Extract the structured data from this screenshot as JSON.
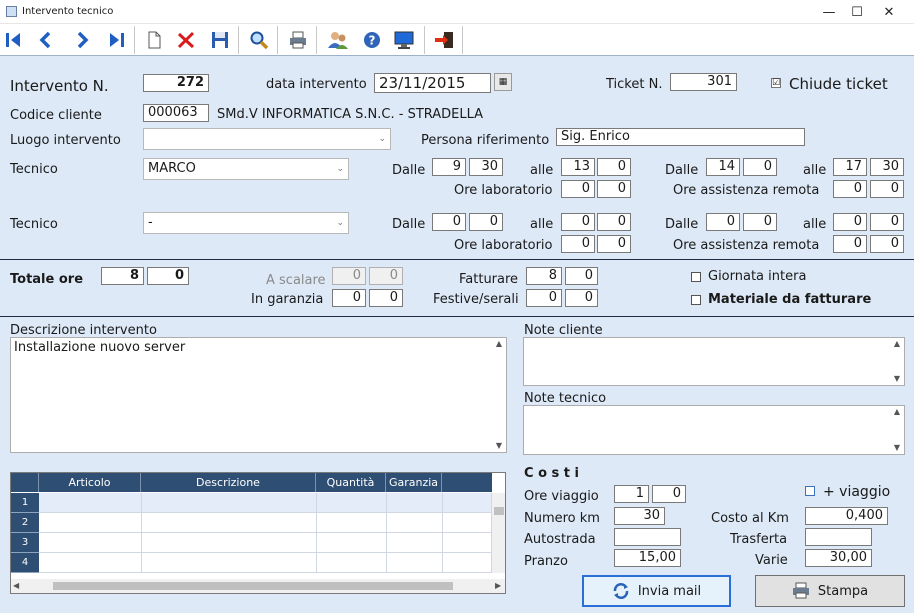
{
  "window": {
    "title": "Intervento tecnico",
    "minimize_icon": "minimize-icon",
    "maximize_icon": "maximize-icon",
    "close_icon": "close-icon"
  },
  "toolbar": {
    "icons": [
      "first-record-icon",
      "prev-record-icon",
      "next-record-icon",
      "last-record-icon",
      "new-document-icon",
      "delete-icon",
      "save-icon",
      "search-icon",
      "print-icon",
      "users-icon",
      "help-icon",
      "monitor-icon",
      "exit-icon"
    ]
  },
  "header": {
    "intervento_label": "Intervento N.",
    "intervento_value": "272",
    "data_label": "data intervento",
    "data_value": "23/11/2015",
    "ticket_label": "Ticket N.",
    "ticket_value": "301",
    "chiude_label": "Chiude ticket",
    "chiude_checked": "☑",
    "codice_label": "Codice cliente",
    "codice_value": "000063",
    "cliente_nome": "SMd.V INFORMATICA S.N.C. - STRADELLA",
    "luogo_label": "Luogo intervento",
    "luogo_value": "",
    "persona_label": "Persona riferimento",
    "persona_value": "Sig. Enrico"
  },
  "tecnici": [
    {
      "label": "Tecnico",
      "name": "MARCO",
      "dalle": "Dalle",
      "alle": "alle",
      "d1h": "9",
      "d1m": "30",
      "a1h": "13",
      "a1m": "0",
      "d2h": "14",
      "d2m": "0",
      "a2h": "17",
      "a2m": "30",
      "lab_label": "Ore laboratorio",
      "lab_h": "0",
      "lab_m": "0",
      "rem_label": "Ore assistenza remota",
      "rem_h": "0",
      "rem_m": "0"
    },
    {
      "label": "Tecnico",
      "name": "-",
      "dalle": "Dalle",
      "alle": "alle",
      "d1h": "0",
      "d1m": "0",
      "a1h": "0",
      "a1m": "0",
      "d2h": "0",
      "d2m": "0",
      "a2h": "0",
      "a2m": "0",
      "lab_label": "Ore laboratorio",
      "lab_h": "0",
      "lab_m": "0",
      "rem_label": "Ore assistenza remota",
      "rem_h": "0",
      "rem_m": "0"
    }
  ],
  "totali": {
    "totale_label": "Totale ore",
    "totale_h": "8",
    "totale_m": "0",
    "scalare_label": "A scalare",
    "scalare_h": "0",
    "scalare_m": "0",
    "garanzia_label": "In garanzia",
    "garanzia_h": "0",
    "garanzia_m": "0",
    "fatturare_label": "Fatturare",
    "fatturare_h": "8",
    "fatturare_m": "0",
    "festive_label": "Festive/serali",
    "festive_h": "0",
    "festive_m": "0",
    "giornata_label": "Giornata intera",
    "materiale_label": "Materiale da fatturare"
  },
  "descrizione": {
    "label": "Descrizione intervento",
    "value": "Installazione nuovo server"
  },
  "note_cliente": {
    "label": "Note cliente",
    "value": ""
  },
  "note_tecnico": {
    "label": "Note tecnico",
    "value": ""
  },
  "grid": {
    "columns": [
      "Articolo",
      "Descrizione",
      "Quantità",
      "Garanzia"
    ],
    "rows": [
      "1",
      "2",
      "3",
      "4"
    ]
  },
  "costi": {
    "title": "C o s t i",
    "viaggio_label": "Ore viaggio",
    "viaggio_h": "1",
    "viaggio_m": "0",
    "piu_viaggio_label": "+ viaggio",
    "km_label": "Numero km",
    "km_value": "30",
    "costo_km_label": "Costo al Km",
    "costo_km_value": "0,400",
    "autostrada_label": "Autostrada",
    "autostrada_value": "",
    "trasferta_label": "Trasferta",
    "trasferta_value": "",
    "pranzo_label": "Pranzo",
    "pranzo_value": "15,00",
    "varie_label": "Varie",
    "varie_value": "30,00"
  },
  "buttons": {
    "mail_label": "Invia mail",
    "stampa_label": "Stampa"
  }
}
